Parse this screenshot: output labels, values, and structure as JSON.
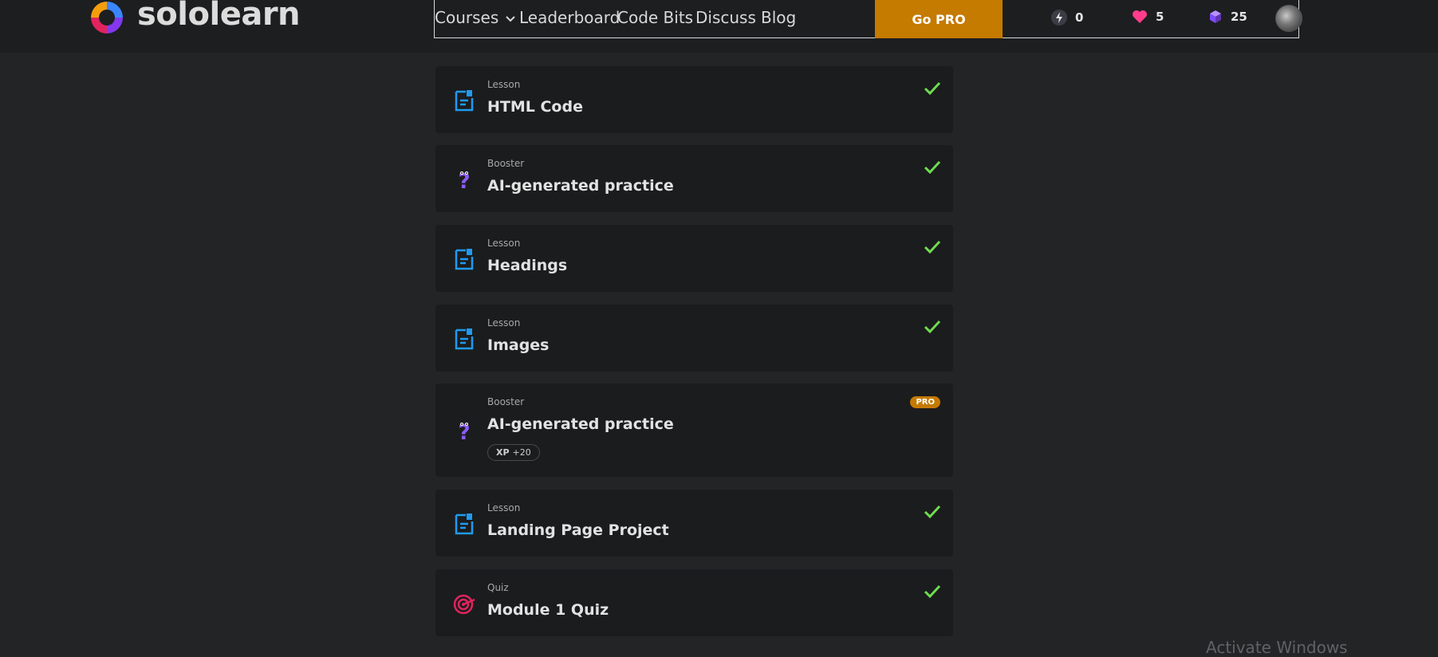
{
  "brand": {
    "name": "sololearn"
  },
  "nav": {
    "courses": "Courses",
    "leaderboard": "Leaderboard",
    "code_bits": "Code Bits",
    "discuss": "Discuss",
    "blog": "Blog",
    "go_pro": "Go PRO",
    "streak": "0",
    "hearts": "5",
    "gems": "25"
  },
  "lessons": [
    {
      "type": "Lesson",
      "title": "HTML Code",
      "icon": "lesson-doc-icon",
      "status": "completed"
    },
    {
      "type": "Booster",
      "title": "AI-generated practice",
      "icon": "question-mark-icon",
      "status": "completed"
    },
    {
      "type": "Lesson",
      "title": "Headings",
      "icon": "lesson-doc-icon",
      "status": "completed"
    },
    {
      "type": "Lesson",
      "title": "Images",
      "icon": "lesson-doc-icon",
      "status": "completed"
    },
    {
      "type": "Booster",
      "title": "AI-generated practice",
      "icon": "question-mark-icon",
      "status": "locked-pro",
      "badge": "PRO",
      "xp_label": "XP",
      "xp_value": "+20"
    },
    {
      "type": "Lesson",
      "title": "Landing Page Project",
      "icon": "lesson-doc-icon",
      "status": "completed"
    },
    {
      "type": "Quiz",
      "title": "Module 1 Quiz",
      "icon": "target-icon",
      "status": "completed"
    }
  ],
  "watermark": "Activate Windows",
  "colors": {
    "accent_orange": "#c57a00",
    "check_green": "#6fdc4f",
    "lesson_blue": "#1f9bf0",
    "booster_purple": "#8b5cf6",
    "quiz_pink": "#e0245e",
    "heart_pink": "#ff3d8b"
  }
}
